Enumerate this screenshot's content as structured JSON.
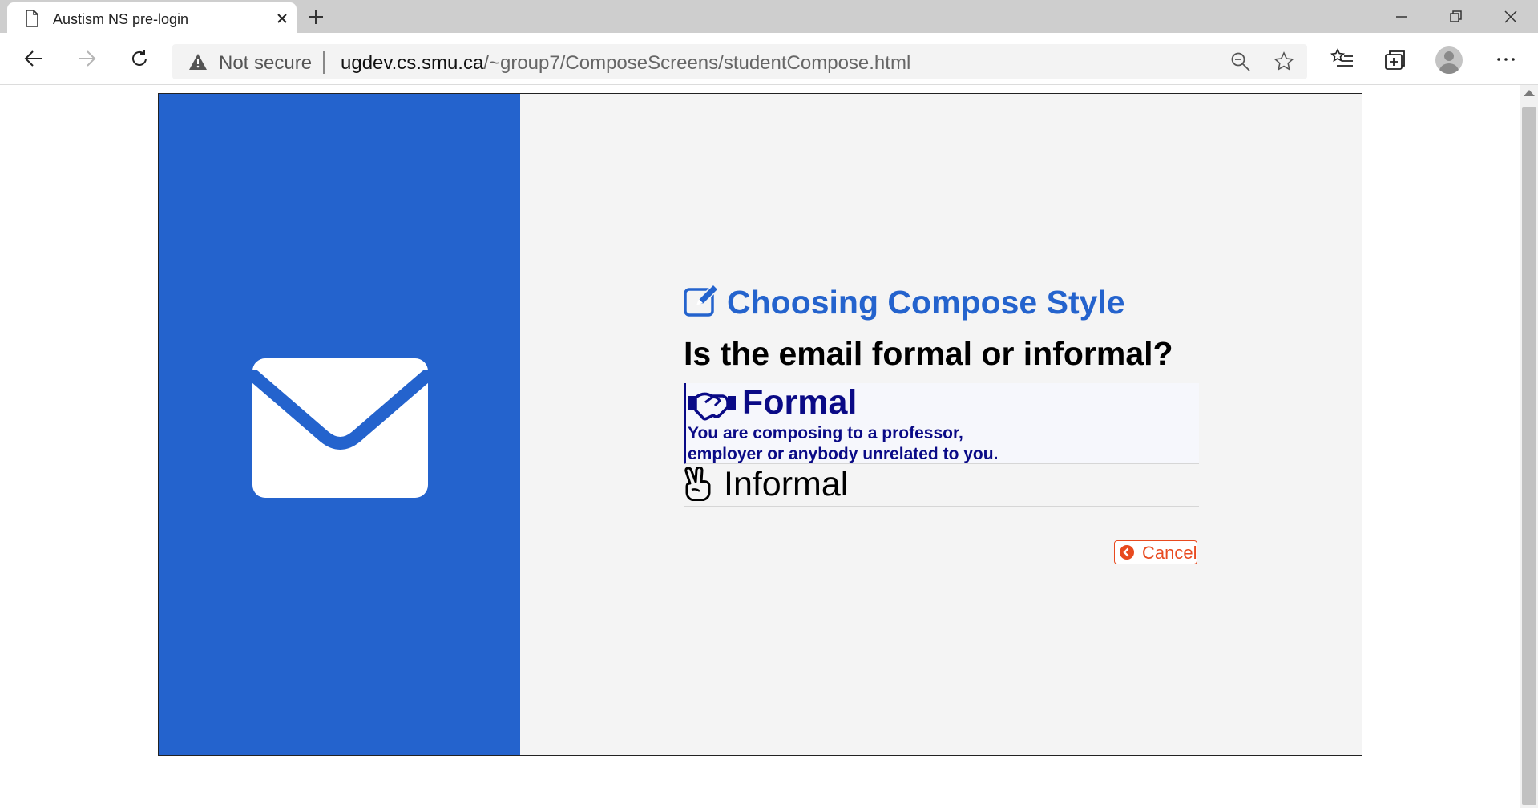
{
  "browser": {
    "tab_title": "Austism NS pre-login",
    "security_label": "Not secure",
    "url_host": "ugdev.cs.smu.ca",
    "url_path": "/~group7/ComposeScreens/studentCompose.html"
  },
  "page": {
    "heading": "Choosing Compose Style",
    "question": "Is the email formal or informal?",
    "options": [
      {
        "title": "Formal",
        "description_line1": "You are composing to a professor,",
        "description_line2": "employer or anybody unrelated to you.",
        "selected": true
      },
      {
        "title": "Informal",
        "selected": false
      }
    ],
    "cancel_label": "Cancel"
  },
  "colors": {
    "side_panel": "#2463cd",
    "heading": "#2463cd",
    "formal_text": "#0a0a86",
    "cancel": "#e84a1f",
    "content_bg": "#f4f4f4"
  }
}
